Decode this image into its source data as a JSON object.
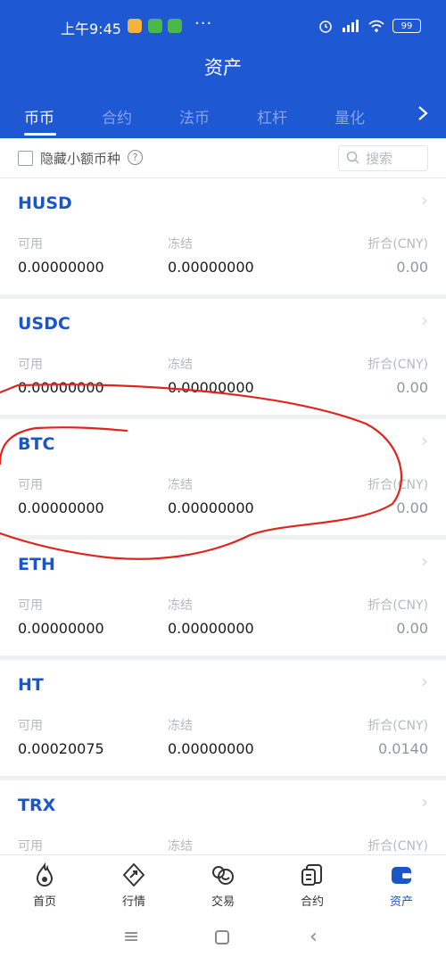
{
  "statusbar": {
    "time": "上午9:45",
    "battery": "99",
    "app_icon_colors": [
      "#f3b33d",
      "#4cb84a",
      "#4cb84a"
    ]
  },
  "header": {
    "title": "资产"
  },
  "tabs": [
    {
      "label": "币币",
      "active": true
    },
    {
      "label": "合约",
      "active": false
    },
    {
      "label": "法币",
      "active": false
    },
    {
      "label": "杠杆",
      "active": false
    },
    {
      "label": "量化",
      "active": false
    }
  ],
  "tab_more_icon": "chevron-right-icon",
  "filter": {
    "hide_small_label": "隐藏小额币种",
    "search_placeholder": "搜索"
  },
  "columns": {
    "available": "可用",
    "frozen": "冻结",
    "cny": "折合(CNY)"
  },
  "assets": [
    {
      "name": "HUSD",
      "available": "0.00000000",
      "frozen": "0.00000000",
      "cny": "0.00"
    },
    {
      "name": "USDC",
      "available": "0.00000000",
      "frozen": "0.00000000",
      "cny": "0.00"
    },
    {
      "name": "BTC",
      "available": "0.00000000",
      "frozen": "0.00000000",
      "cny": "0.00"
    },
    {
      "name": "ETH",
      "available": "0.00000000",
      "frozen": "0.00000000",
      "cny": "0.00"
    },
    {
      "name": "HT",
      "available": "0.00020075",
      "frozen": "0.00000000",
      "cny": "0.0140"
    },
    {
      "name": "TRX",
      "available": "",
      "frozen": "",
      "cny": ""
    }
  ],
  "bottom_nav": [
    {
      "label": "首页",
      "icon": "home-flame-icon",
      "active": false
    },
    {
      "label": "行情",
      "icon": "market-icon",
      "active": false
    },
    {
      "label": "交易",
      "icon": "trade-icon",
      "active": false
    },
    {
      "label": "合约",
      "icon": "contract-icon",
      "active": false
    },
    {
      "label": "资产",
      "icon": "wallet-icon",
      "active": true
    }
  ],
  "colors": {
    "brand_blue": "#1f58d3",
    "asset_name": "#1b56c9",
    "annotation_red": "#e0241b"
  }
}
